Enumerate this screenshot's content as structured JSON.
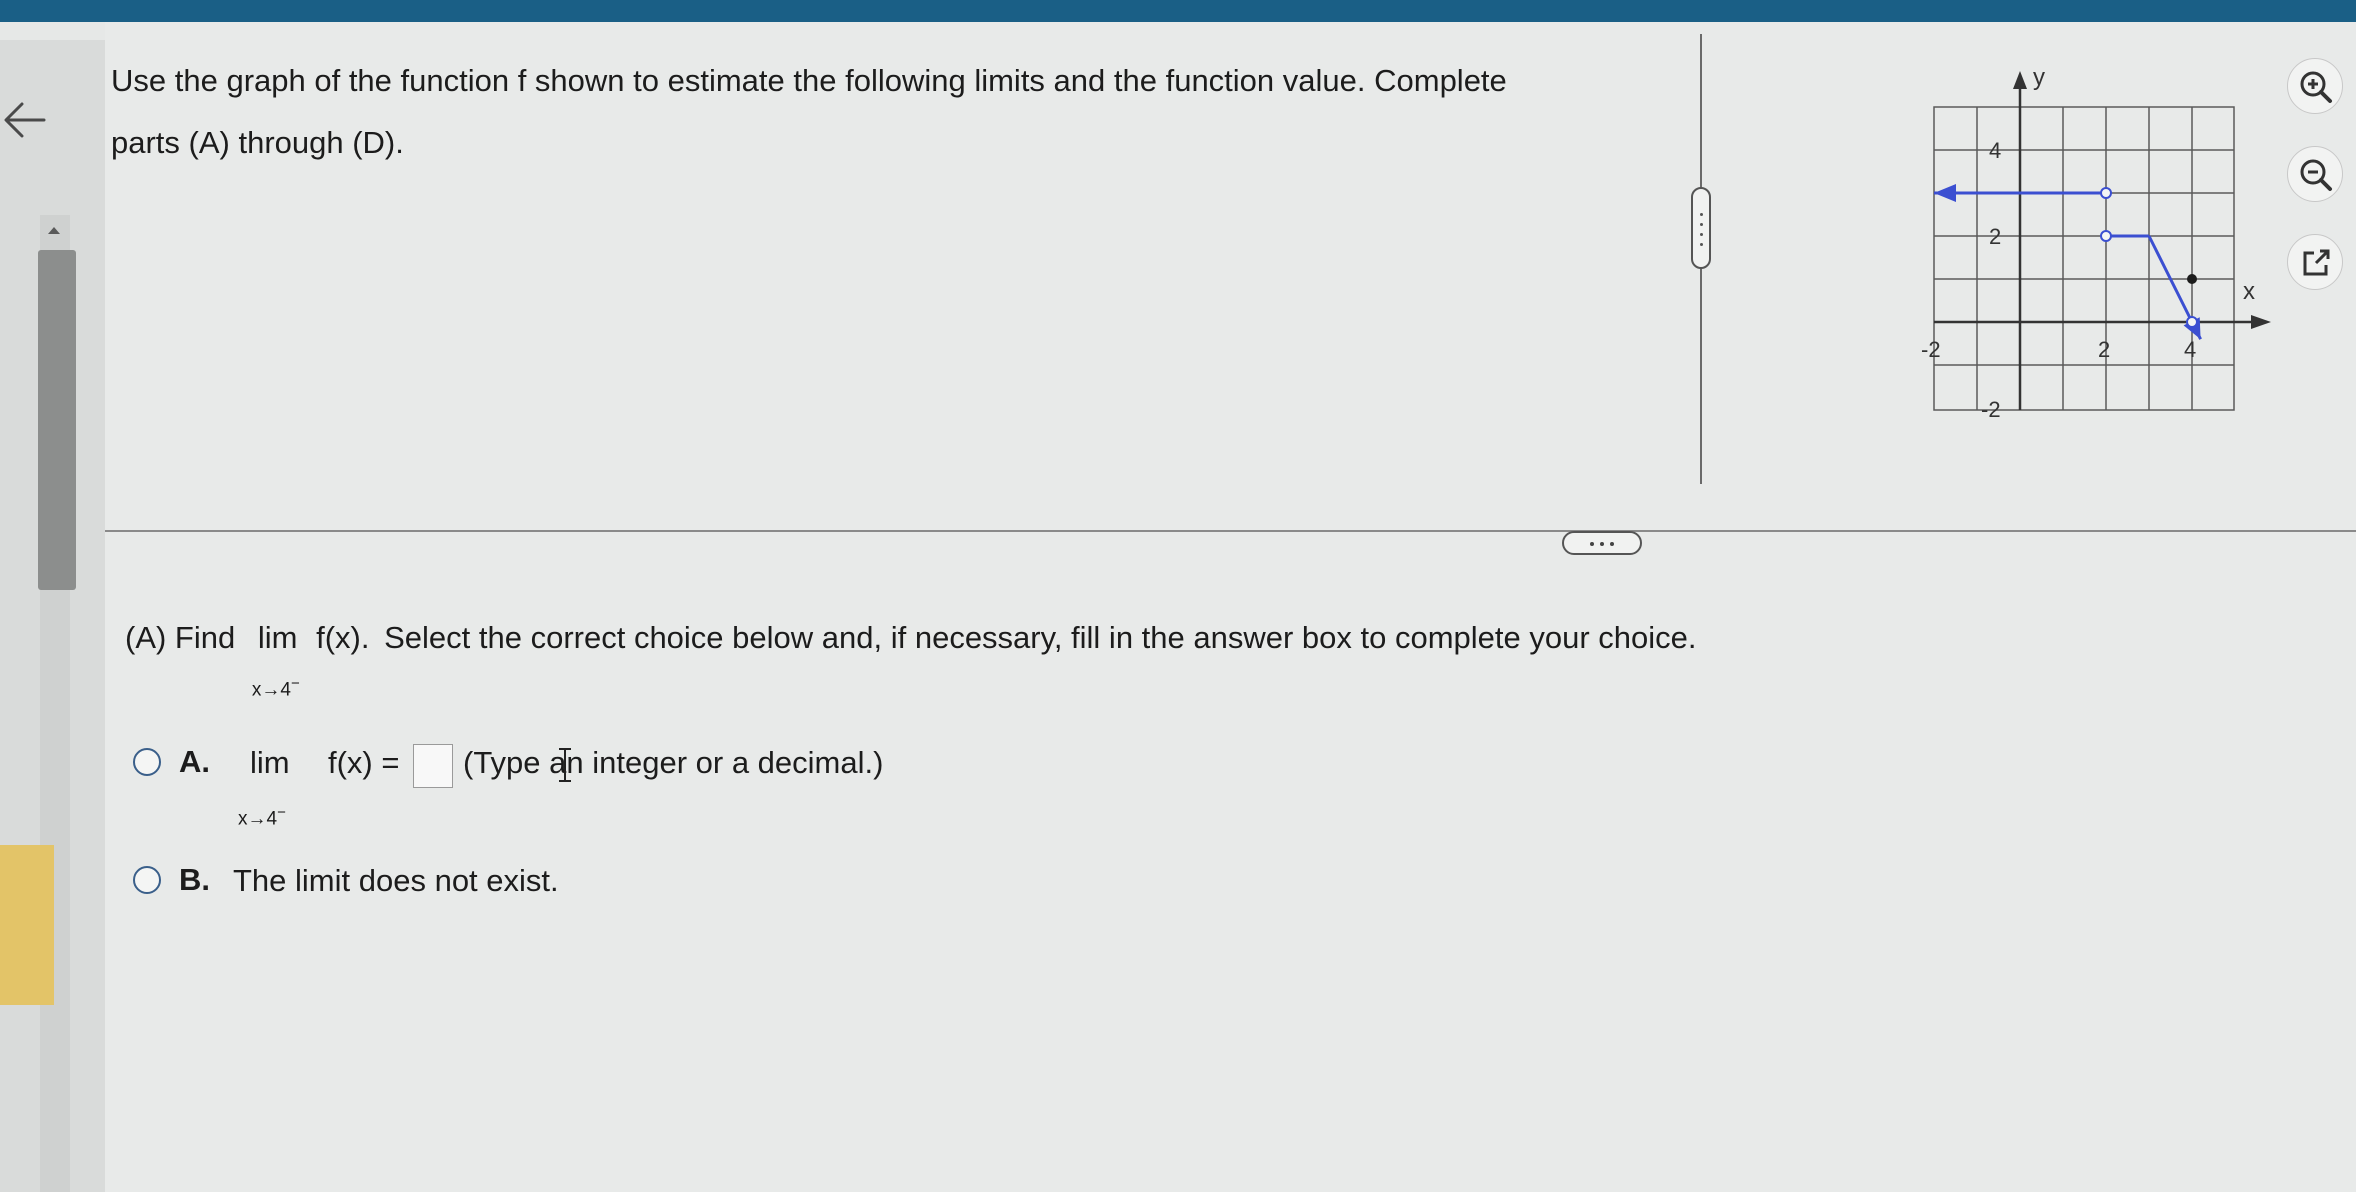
{
  "question": {
    "line1": "Use the graph of the function f shown to estimate the following limits and the function value. Complete",
    "line2": "parts (A) through (D)."
  },
  "graph": {
    "axis_labels": {
      "x": "x",
      "y": "y"
    },
    "tick_labels": {
      "x_neg": "-2",
      "x_pos2": "2",
      "x_pos4": "4",
      "y_pos4": "4",
      "y_pos2": "2",
      "y_neg2": "-2"
    },
    "line_color": "#3b4fd1",
    "segments": [
      {
        "from": [
          -2,
          3
        ],
        "to": [
          2,
          3
        ],
        "left_arrow": true,
        "right_end": "open"
      },
      {
        "from": [
          2,
          2
        ],
        "to": [
          3,
          2
        ],
        "left_end": "open"
      },
      {
        "from": [
          3,
          2
        ],
        "to": [
          4,
          0
        ],
        "right_end": "open"
      },
      {
        "from": [
          4,
          0
        ],
        "to": [
          4.2,
          -0.4
        ],
        "right_arrow": true
      }
    ],
    "points": [
      {
        "x": 2,
        "y": 3,
        "style": "open"
      },
      {
        "x": 2,
        "y": 2,
        "style": "open"
      },
      {
        "x": 4,
        "y": 1,
        "style": "closed"
      },
      {
        "x": 4,
        "y": 0,
        "style": "open"
      }
    ]
  },
  "toolbar": {
    "zoom_in": "zoom-in-icon",
    "zoom_out": "zoom-out-icon",
    "open_external": "external-link-icon"
  },
  "part_a": {
    "prefix": "(A) Find",
    "lim": "lim",
    "func": "f(x).",
    "sub": "x→4",
    "sup": "−",
    "instruction": "Select the correct choice below and, if necessary, fill in the answer box to complete your choice."
  },
  "choices": [
    {
      "letter": "A.",
      "lim": "lim",
      "func_eq": "f(x) =",
      "sub": "x→4",
      "sup": "−",
      "hint": "(Type an integer or a decimal.)"
    },
    {
      "letter": "B.",
      "text": "The limit does not exist."
    }
  ]
}
